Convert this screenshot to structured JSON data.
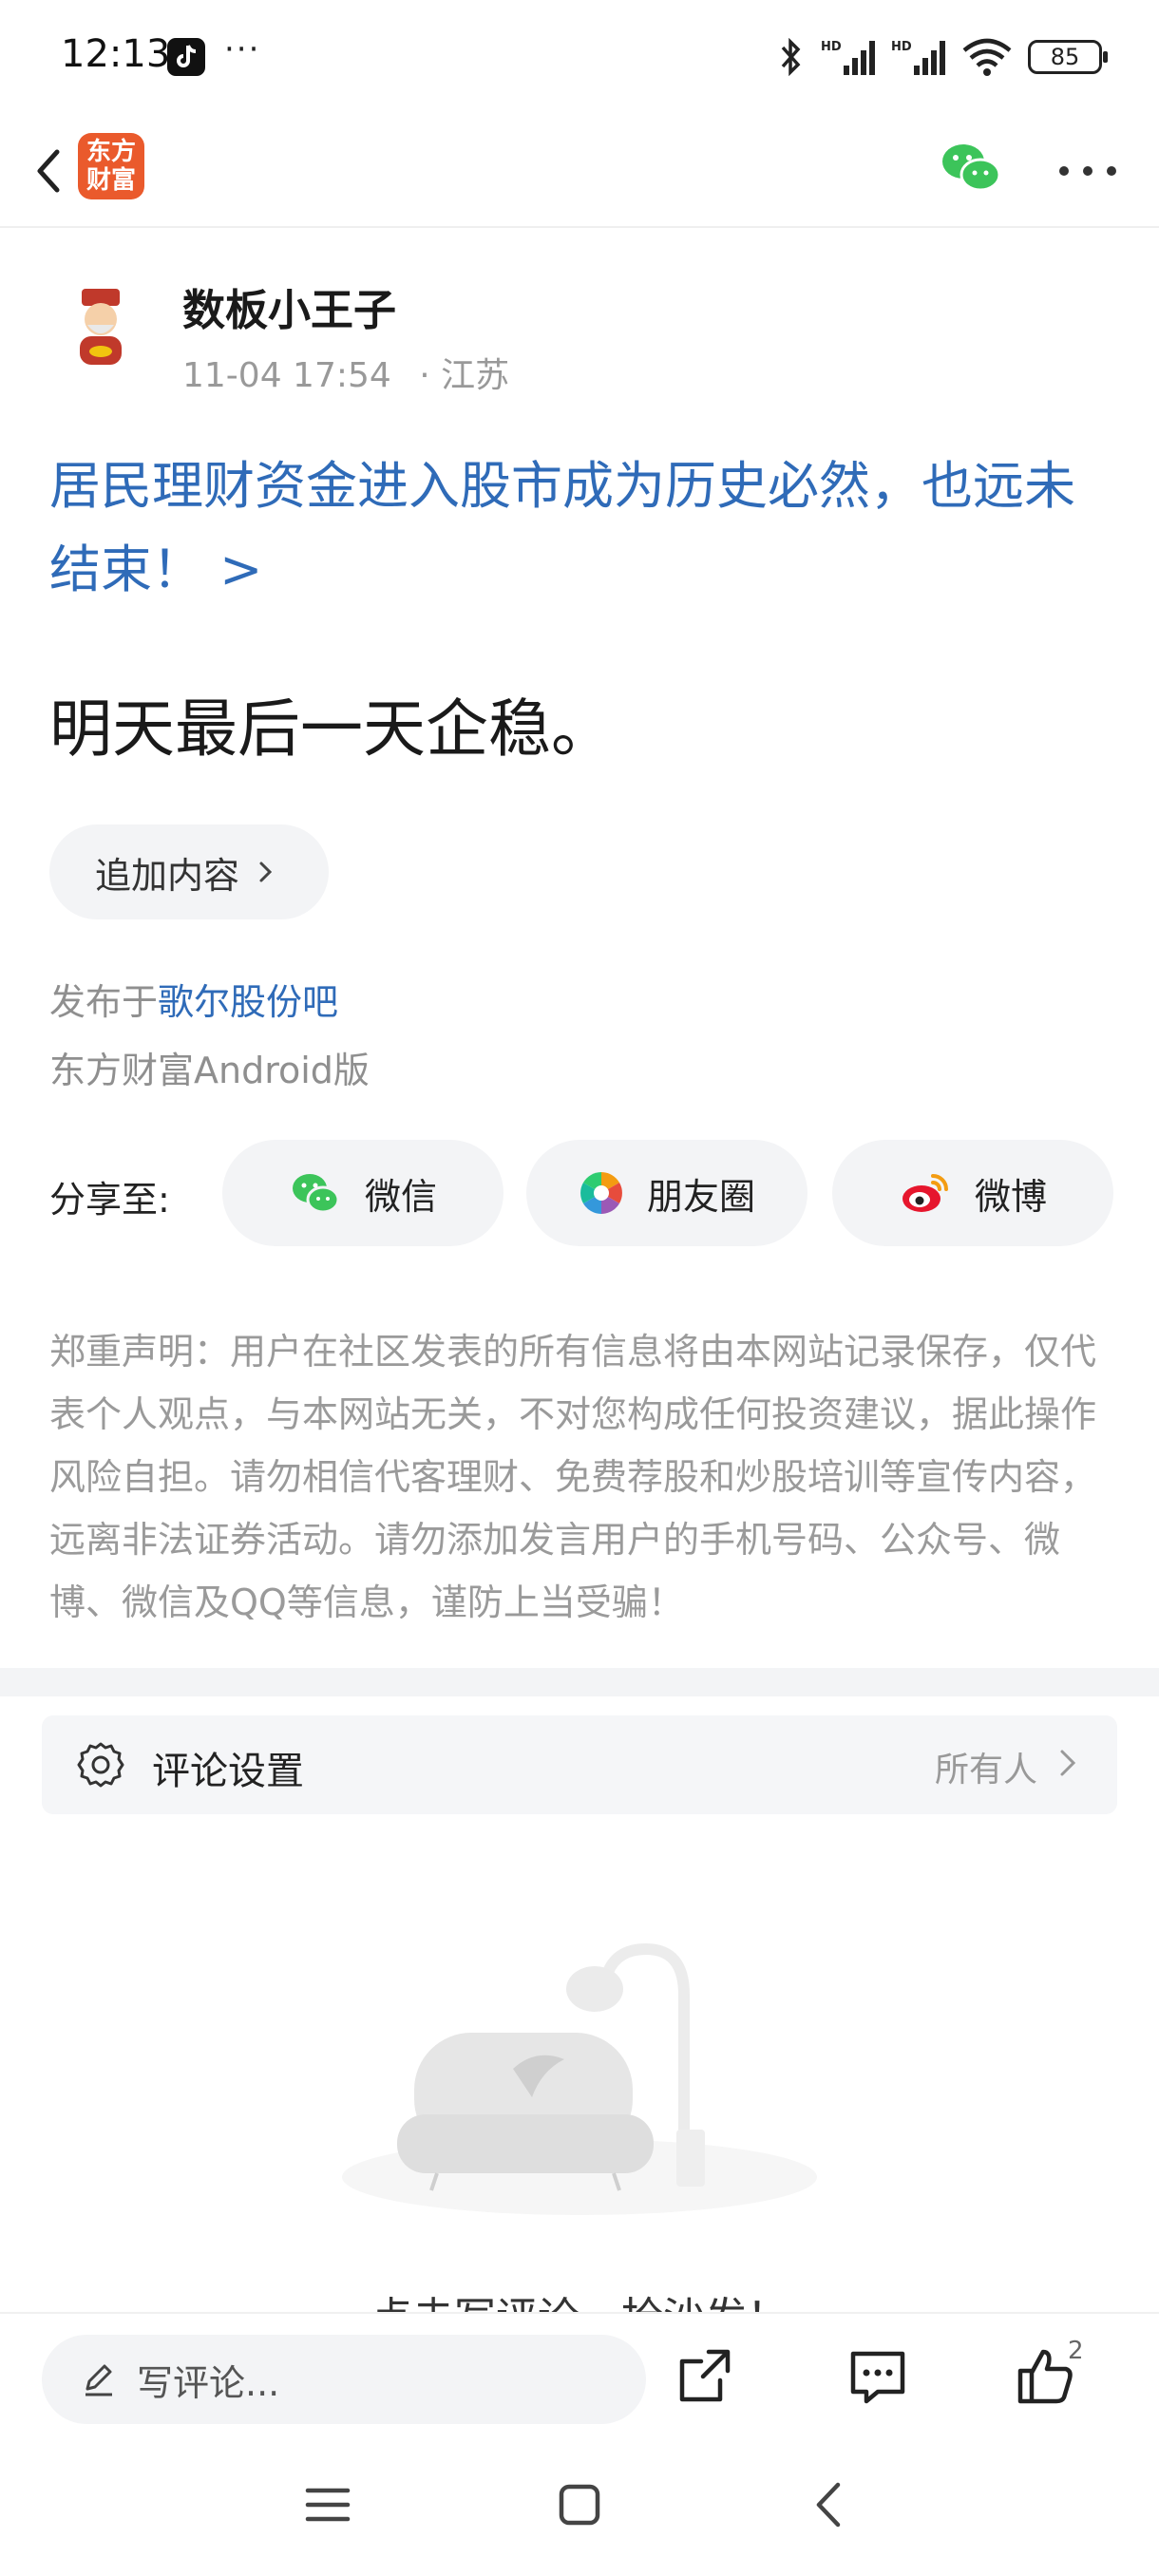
{
  "status_bar": {
    "time": "12:13",
    "more_dots": "···",
    "battery": "85",
    "icons": [
      "tiktok-icon",
      "bluetooth-icon",
      "signal-hd-icon",
      "signal-hd-icon",
      "wifi-icon",
      "battery-icon"
    ]
  },
  "nav": {
    "brand_logo_text": "东方\n财富",
    "icons": [
      "back-arrow-icon",
      "wechat-icon",
      "more-icon"
    ]
  },
  "author": {
    "name": "数板小王子",
    "time": "11-04 17:54",
    "location": "· 江苏"
  },
  "post": {
    "title": "居民理财资金进入股市成为历史必然，也远未结束！ >",
    "body": "明天最后一天企稳。",
    "append_label": "追加内容",
    "published_prefix": "发布于",
    "bar_name": "歌尔股份吧",
    "client": "东方财富Android版"
  },
  "share": {
    "label": "分享至:",
    "targets": [
      {
        "label": "微信",
        "icon": "wechat-icon"
      },
      {
        "label": "朋友圈",
        "icon": "moments-icon"
      },
      {
        "label": "微博",
        "icon": "weibo-icon"
      }
    ]
  },
  "disclaimer": "郑重声明：用户在社区发表的所有信息将由本网站记录保存，仅代表个人观点，与本网站无关，不对您构成任何投资建议，据此操作风险自担。请勿相信代客理财、免费荐股和炒股培训等宣传内容，远离非法证券活动。请勿添加发言用户的手机号码、公众号、微博、微信及QQ等信息，谨防上当受骗！",
  "comments": {
    "settings_label": "评论设置",
    "settings_value": "所有人",
    "empty_text": "点击写评论，抢沙发！"
  },
  "bottom_bar": {
    "input_placeholder": "写评论...",
    "like_count": "2",
    "icons": [
      "pencil-icon",
      "share-out-icon",
      "comment-icon",
      "thumb-up-icon"
    ]
  },
  "colors": {
    "link_blue": "#2f6bb8",
    "brand_orange": "#ea5a2c",
    "wechat_green": "#3cc45a",
    "weibo_red": "#e6162d",
    "pill_bg": "#f3f4f6"
  }
}
